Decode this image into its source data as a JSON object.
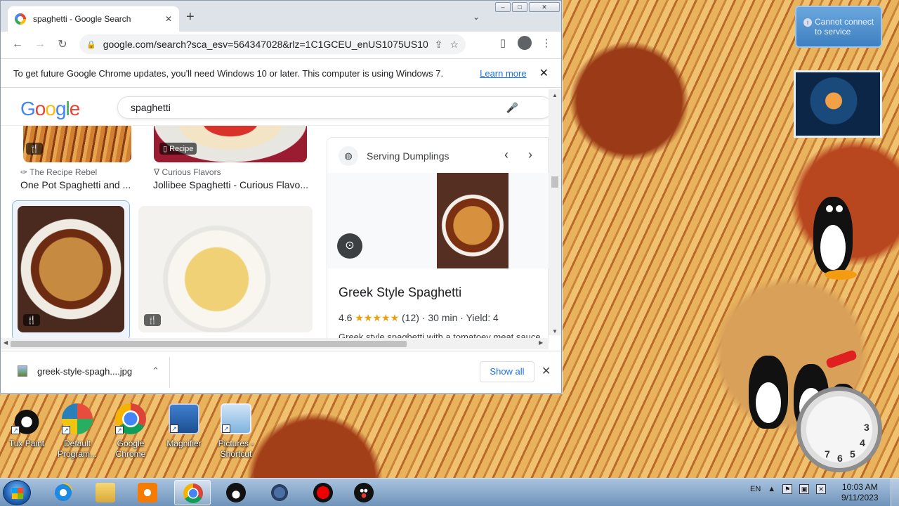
{
  "browser": {
    "tab_title": "spaghetti - Google Search",
    "new_tab_symbol": "+",
    "tab_close_symbol": "✕",
    "url": "google.com/search?sca_esv=564347028&rlz=1C1GCEU_enUS1075US1075...",
    "window_controls": [
      "–",
      "□",
      "✕"
    ]
  },
  "infobar": {
    "message": "To get future Google Chrome updates, you'll need Windows 10 or later. This computer is using Windows 7.",
    "link": "Learn more",
    "close": "✕"
  },
  "search": {
    "logo_letters": [
      {
        "ch": "G",
        "color": "#4285f4"
      },
      {
        "ch": "o",
        "color": "#ea4335"
      },
      {
        "ch": "o",
        "color": "#fbbc05"
      },
      {
        "ch": "g",
        "color": "#4285f4"
      },
      {
        "ch": "l",
        "color": "#34a853"
      },
      {
        "ch": "e",
        "color": "#ea4335"
      }
    ],
    "query": "spaghetti"
  },
  "results": [
    {
      "source": "The Recipe Rebel",
      "title": "One Pot Spaghetti and ...",
      "badge": ""
    },
    {
      "source": "Curious Flavors",
      "title": "Jollibee Spaghetti - Curious Flavo...",
      "badge": "Recipe"
    },
    {
      "source": "",
      "title": "",
      "badge": "🍴"
    },
    {
      "source": "",
      "title": "",
      "badge": "🍴"
    }
  ],
  "panel": {
    "site": "Serving Dumplings",
    "title": "Greek Style Spaghetti",
    "rating": "4.6",
    "stars": "★★★★★",
    "reviews": "(12)",
    "time": "30 min",
    "yield": "Yield: 4",
    "description": "Greek style spaghetti with a tomatoey meat sauce"
  },
  "download_shelf": {
    "filename": "greek-style-spagh....jpg",
    "show_all": "Show all",
    "close": "✕"
  },
  "desktop_icons": [
    {
      "label1": "Tux Paint",
      "label2": "",
      "color": "#222"
    },
    {
      "label1": "Default",
      "label2": "Program...",
      "color": "#3a8fd8"
    },
    {
      "label1": "Google",
      "label2": "Chrome",
      "color": "#db4437"
    },
    {
      "label1": "Magnifier",
      "label2": "",
      "color": "#2f6fb8"
    },
    {
      "label1": "Pictures -",
      "label2": "Shortcut",
      "color": "#5fa0d8"
    }
  ],
  "gadget": {
    "message": "Cannot connect to service"
  },
  "clock_numbers": [
    "3",
    "4",
    "5",
    "6",
    "7"
  ],
  "taskbar": {
    "language": "EN",
    "time": "10:03 AM",
    "date": "9/11/2023"
  }
}
